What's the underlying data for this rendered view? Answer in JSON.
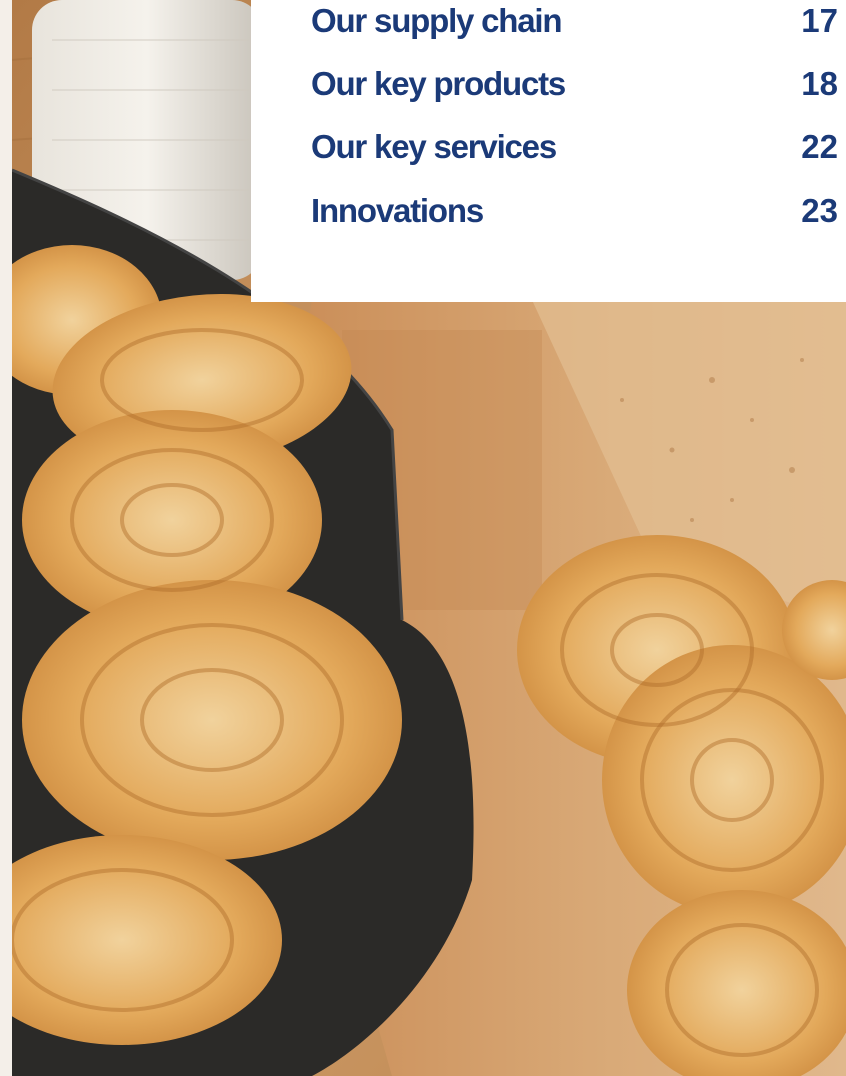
{
  "toc": {
    "entries": [
      {
        "title": "Our supply chain",
        "page": "17"
      },
      {
        "title": "Our key products",
        "page": "18"
      },
      {
        "title": "Our key services",
        "page": "22"
      },
      {
        "title": "Innovations",
        "page": "23"
      }
    ]
  },
  "colors": {
    "toc_text": "#1b3a78",
    "panel_bg": "#ffffff",
    "wood": "#c8935e",
    "cloth": "#2b2b2b",
    "pastry": "#e6b06a"
  },
  "photo": {
    "subject": "palmier-pastries-on-wooden-board"
  }
}
